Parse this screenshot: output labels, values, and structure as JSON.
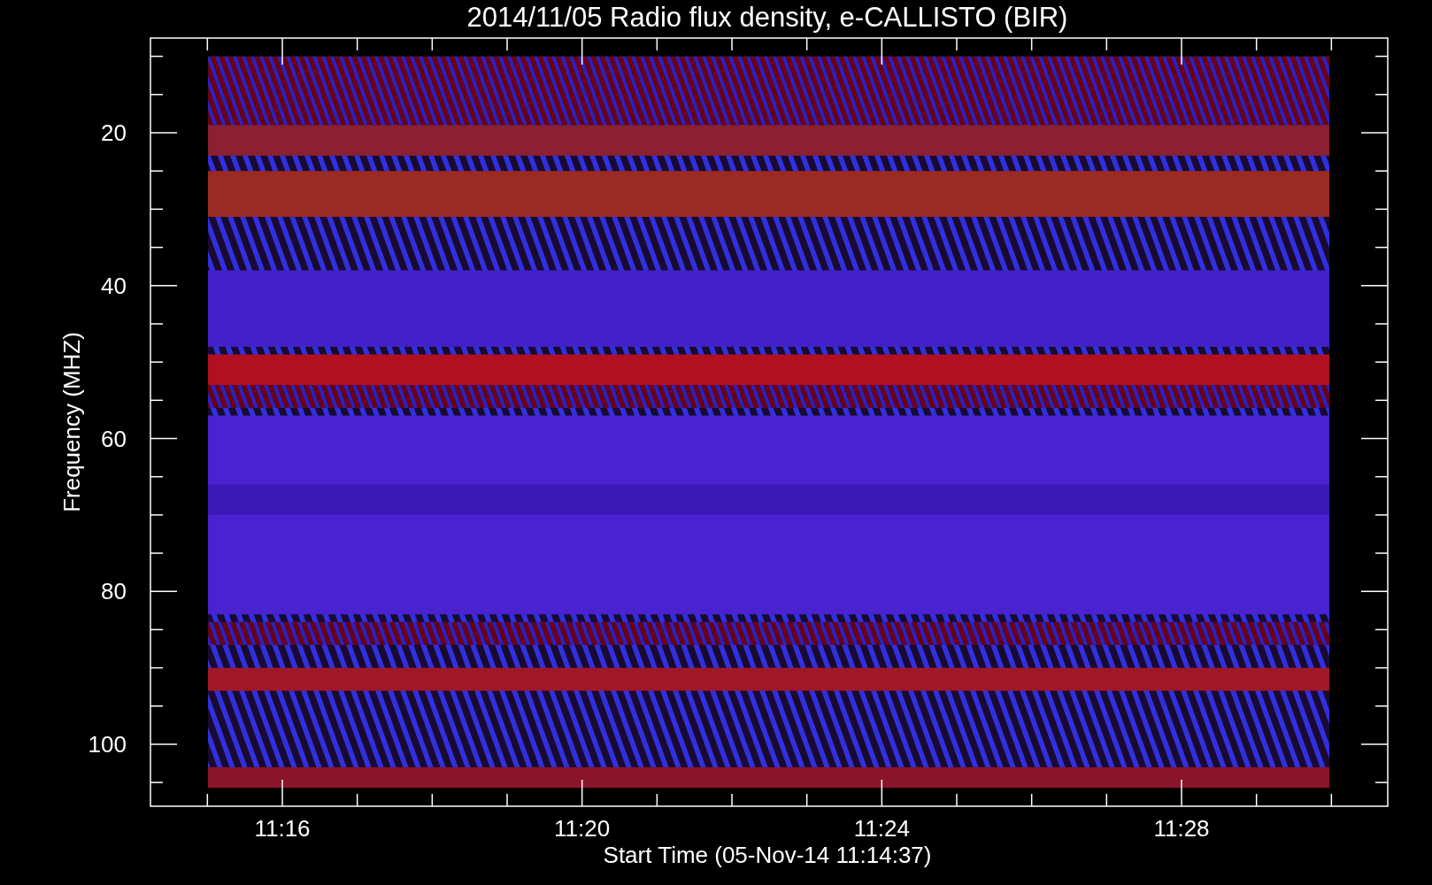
{
  "title": "2014/11/05  Radio flux density, e-CALLISTO (BIR)",
  "y_axis": {
    "label": "Frequency (MHZ)",
    "ticks": [
      "20",
      "40",
      "60",
      "80",
      "100"
    ]
  },
  "x_axis": {
    "label": "Start Time (05-Nov-14 11:14:37)",
    "ticks": [
      "11:16",
      "11:20",
      "11:24",
      "11:28"
    ]
  }
}
